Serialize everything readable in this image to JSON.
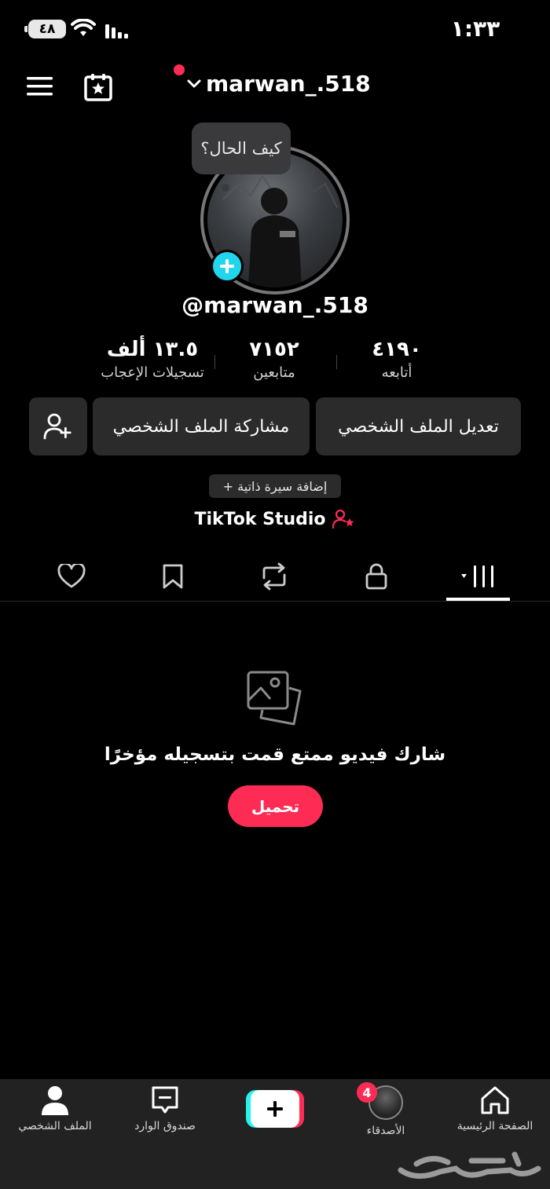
{
  "status_bar": {
    "time": "١:٣٣",
    "battery": "٤٨"
  },
  "header": {
    "username": "marwan_.518"
  },
  "profile": {
    "bubble_text": "كيف الحال؟",
    "handle": "@marwan_.518",
    "stats": {
      "likes": {
        "value": "١٣.٥ ألف",
        "label": "تسجيلات الإعجاب"
      },
      "followers": {
        "value": "٧١٥٢",
        "label": "متابعين"
      },
      "following": {
        "value": "٤١٩٠",
        "label": "أتابعه"
      }
    },
    "buttons": {
      "share": "مشاركة الملف الشخصي",
      "edit": "تعديل الملف الشخصي"
    },
    "bio_chip": "+ إضافة سيرة ذاتية",
    "studio": "TikTok Studio"
  },
  "empty_state": {
    "message": "شارك فيديو ممتع قمت بتسجيله مؤخرًا",
    "upload": "تحميل"
  },
  "bottom_nav": {
    "profile": "الملف الشخصي",
    "inbox": "صندوق الوارد",
    "friends": "الأصدقاء",
    "friends_badge": "4",
    "home": "الصفحة الرئيسية"
  },
  "colors": {
    "accent": "#fe2c55",
    "cyan": "#25f4ee",
    "add_avatar": "#20d5ec"
  }
}
